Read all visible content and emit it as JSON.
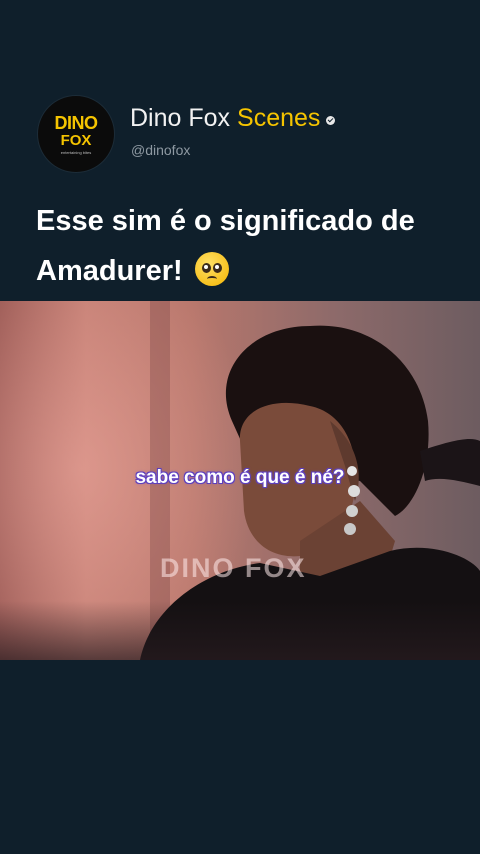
{
  "account": {
    "logo_line1": "DINO",
    "logo_line2": "FOX",
    "logo_tagline": "entertaining bites",
    "name_part1": "Dino Fox",
    "name_part2": "Scenes",
    "handle": "@dinofox",
    "verified": true
  },
  "post": {
    "caption": "Esse sim é o significado de Amadurer!",
    "emoji": "pleading-face"
  },
  "video": {
    "subtitle": "sabe como é que é né?",
    "watermark": "DINO FOX"
  },
  "colors": {
    "background": "#0f1f2b",
    "accent": "#f5c400",
    "text": "#ffffff",
    "subtitle_outline": "#5a3db8"
  }
}
